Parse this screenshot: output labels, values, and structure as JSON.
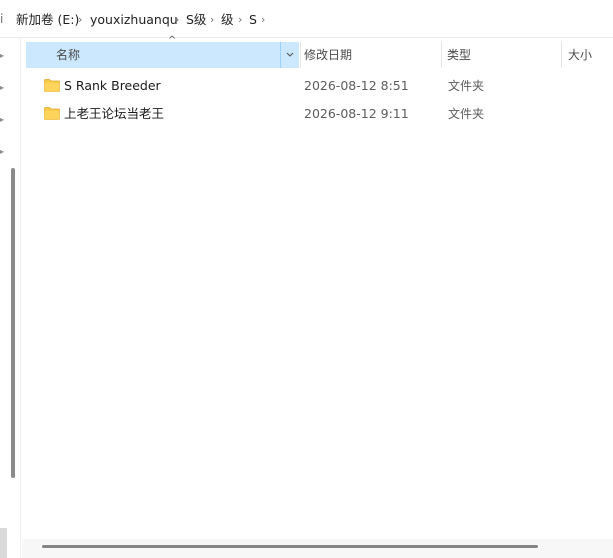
{
  "breadcrumb": {
    "items": [
      {
        "label": "新加卷 (E:)"
      },
      {
        "label": "youxizhuanqu"
      },
      {
        "label": "S级"
      },
      {
        "label": "级"
      },
      {
        "label": "S"
      }
    ],
    "separator": "›"
  },
  "columns": {
    "name": "名称",
    "date_modified": "修改日期",
    "type": "类型",
    "size": "大小"
  },
  "files": [
    {
      "name": "S Rank Breeder",
      "date": "2026-08-12 8:51",
      "type": "文件夹",
      "icon": "folder-icon"
    },
    {
      "name": "上老王论坛当老王",
      "date": "2026-08-12 9:11",
      "type": "文件夹",
      "icon": "folder-icon"
    }
  ],
  "colors": {
    "selected_header": "#cce8ff",
    "folder_yellow": "#f8c945"
  }
}
